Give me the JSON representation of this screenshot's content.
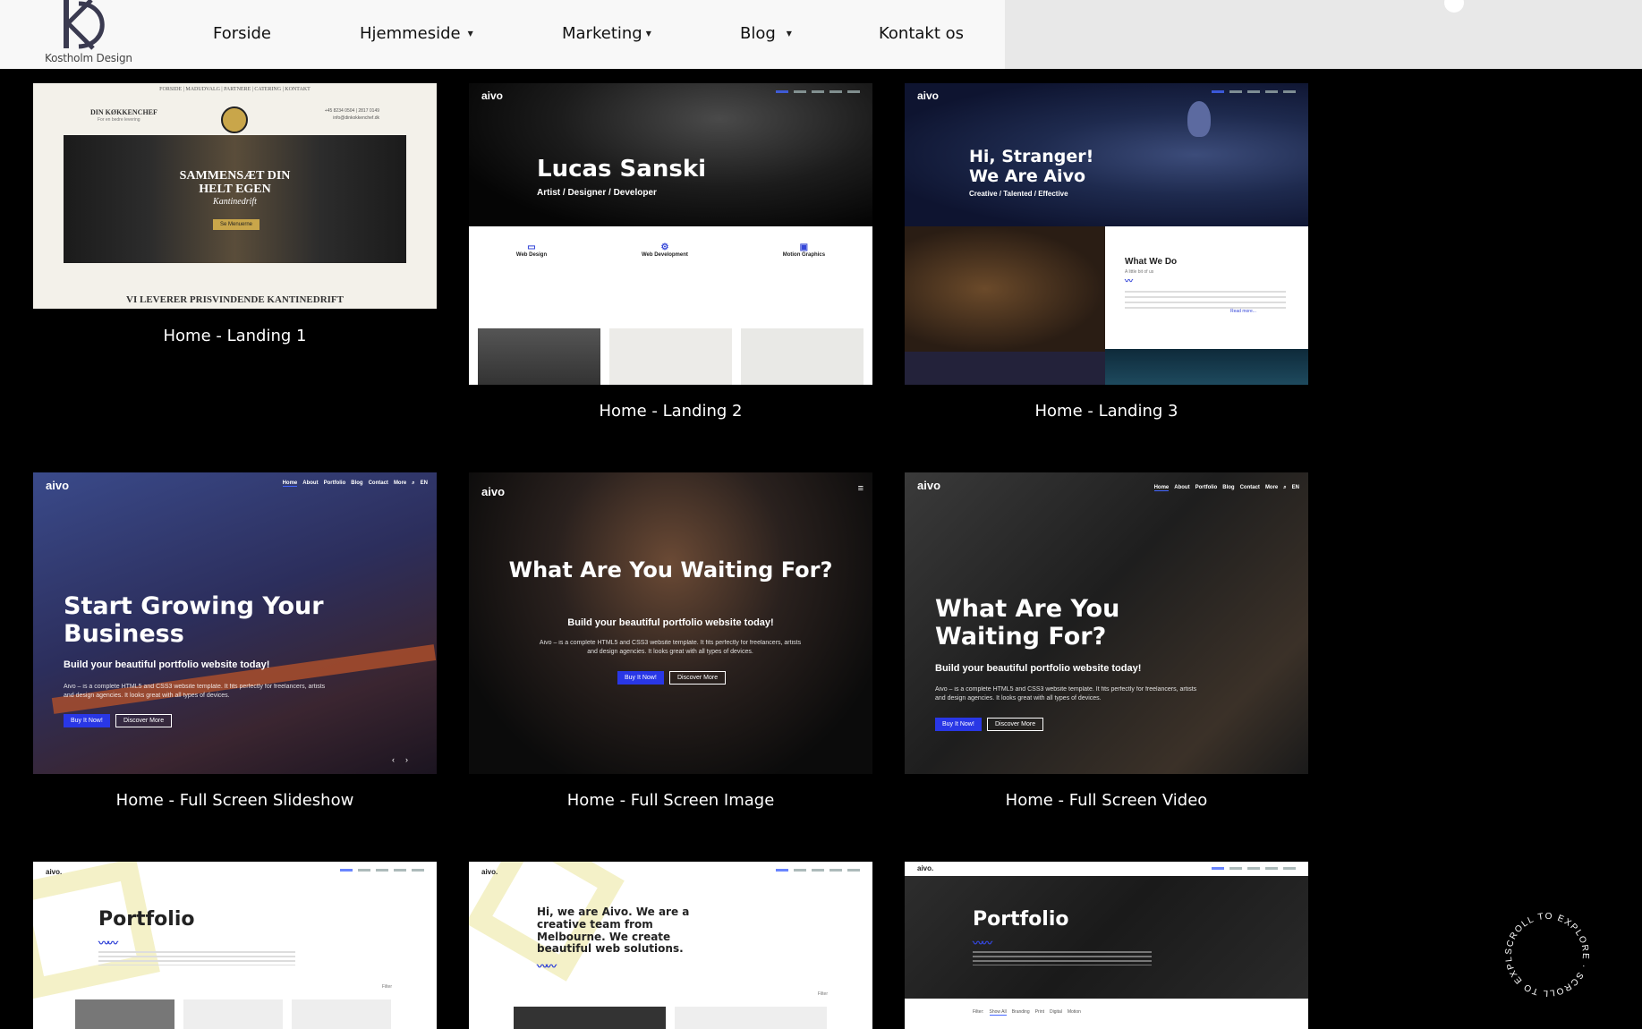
{
  "brand": {
    "logo_text": "Kostholm Design"
  },
  "nav": [
    {
      "label": "Forside",
      "dropdown": false
    },
    {
      "label": "Hjemmeside",
      "dropdown": true
    },
    {
      "label": "Marketing",
      "dropdown": true
    },
    {
      "label": "Blog",
      "dropdown": true
    },
    {
      "label": "Kontakt os",
      "dropdown": false
    }
  ],
  "cards": [
    {
      "label": "Home - Landing 1",
      "thumb": {
        "topnav": "FORSIDE | MADUDVALG | PARTNERE | CATERING | KONTAKT",
        "brand": "DIN KØKKENCHEF",
        "brand_sub": "For en bedre levering",
        "phone": "+45 8234 0504 | 2817 0149",
        "email": "info@dinkokkenchef.dk",
        "headline_1": "SAMMENSÆT DIN",
        "headline_2": "HELT EGEN",
        "headline_3": "Kantinedrift",
        "cta": "Se Menuerne",
        "footer": "VI LEVERER PRISVINDENDE KANTINEDRIFT"
      }
    },
    {
      "label": "Home - Landing 2",
      "thumb": {
        "logo": "aivo",
        "title": "Lucas Sanski",
        "subtitle": "Artist / Designer / Developer",
        "features": [
          "Web Design",
          "Web Development",
          "Motion Graphics"
        ]
      }
    },
    {
      "label": "Home - Landing 3",
      "thumb": {
        "logo": "aivo",
        "title_1": "Hi, Stranger!",
        "title_2": "We Are Aivo",
        "subtitle": "Creative / Talented / Effective",
        "box_title": "What We Do",
        "box_sub": "A little bit of us",
        "read_more": "Read more..."
      }
    },
    {
      "label": "Home - Full Screen Slideshow",
      "thumb": {
        "logo": "aivo",
        "title": "Start Growing Your Business",
        "subtitle": "Build your beautiful portfolio website today!",
        "para": "Aivo – is a complete HTML5 and CSS3 website template. It fits perfectly for freelancers, artists and design agencies. It looks great with all types of devices.",
        "btn_primary": "Buy It Now!",
        "btn_secondary": "Discover More",
        "menu": [
          "Home",
          "About",
          "Portfolio",
          "Blog",
          "Contact",
          "More"
        ],
        "lang": "EN"
      }
    },
    {
      "label": "Home - Full Screen Image",
      "thumb": {
        "logo": "aivo",
        "title": "What Are You Waiting For?",
        "subtitle": "Build your beautiful portfolio website today!",
        "para": "Aivo – is a complete HTML5 and CSS3 website template. It fits perfectly for freelancers, artists and design agencies. It looks great with all types of devices.",
        "btn_primary": "Buy It Now!",
        "btn_secondary": "Discover More"
      }
    },
    {
      "label": "Home - Full Screen Video",
      "thumb": {
        "logo": "aivo",
        "title": "What Are You Waiting For?",
        "subtitle": "Build your beautiful portfolio website today!",
        "para": "Aivo – is a complete HTML5 and CSS3 website template. It fits perfectly for freelancers, artists and design agencies. It looks great with all types of devices.",
        "btn_primary": "Buy It Now!",
        "btn_secondary": "Discover More",
        "menu": [
          "Home",
          "About",
          "Portfolio",
          "Blog",
          "Contact",
          "More"
        ],
        "lang": "EN"
      }
    },
    {
      "label": "",
      "thumb": {
        "logo": "aivo.",
        "title": "Portfolio",
        "filter": "Filter"
      }
    },
    {
      "label": "",
      "thumb": {
        "logo": "aivo.",
        "title": "Hi, we are Aivo. We are a creative team from Melbourne. We create beautiful web solutions.",
        "filter": "Filter"
      }
    },
    {
      "label": "",
      "thumb": {
        "logo": "aivo.",
        "title": "Portfolio",
        "filters": [
          "Filter:",
          "Show All",
          "Branding",
          "Print",
          "Digital",
          "Motion"
        ]
      }
    }
  ],
  "scroll_badge": {
    "text": "SCROLL TO EXPLORE · SCROLL TO EXPLORE ·"
  },
  "colors": {
    "accent": "#2937e6",
    "header_bg": "#f8f8f8",
    "page_bg": "#000000"
  }
}
